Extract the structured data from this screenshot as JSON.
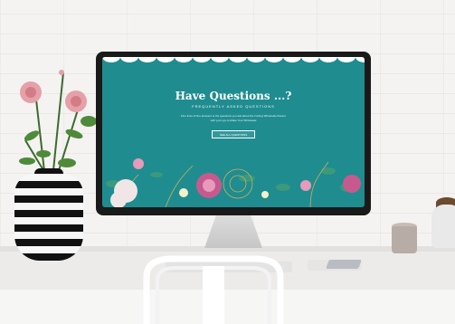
{
  "scene": {
    "monitor_page": {
      "title": "Have Questions ...?",
      "subtitle": "FREQUENTLY ASKED QUESTIONS",
      "body": "Fine lines of fine answers to the questions you ask about the Inviting Wholesale flowers with your eye to Make Your Wholesale",
      "button": "SEE ALL QUESTIONS"
    },
    "colors": {
      "screen_bg": "#1f8c90",
      "monitor_frame": "#1a1a1a",
      "wall": "#f4f3f1"
    }
  }
}
